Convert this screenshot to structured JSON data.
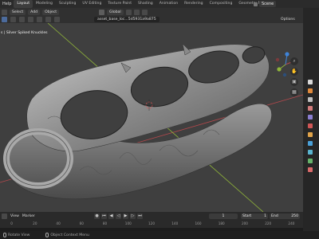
{
  "topbar": {
    "menus": [
      "Help",
      "Layout",
      "Modeling",
      "Sculpting",
      "UV Editing",
      "Texture Paint",
      "Shading",
      "Animation",
      "Rendering",
      "Compositing",
      "Geometry No"
    ],
    "scene_label": "Scene"
  },
  "header": {
    "select": "Select",
    "add": "Add",
    "object": "Object",
    "transform_orientation": "Global"
  },
  "header2": {
    "filename": "asset_base_loc...5d5931a9a875",
    "options": "Options"
  },
  "viewport": {
    "object_label": "s | Silver Spiked Knuckles",
    "colors": {
      "background": "#3f3f3f",
      "x_axis": "#b5484c",
      "y_axis": "#8fb33a",
      "z_axis": "#3f84d8",
      "object_light": "#b8b8b8",
      "object_dark": "#5a5a5a"
    }
  },
  "timeline": {
    "view": "View",
    "marker": "Marker",
    "current_frame": "1",
    "start_label": "Start",
    "start_value": "1",
    "end_label": "End",
    "end_value": "250",
    "ruler": [
      "0",
      "20",
      "40",
      "60",
      "80",
      "100",
      "120",
      "140",
      "160",
      "180",
      "200",
      "220",
      "240"
    ]
  },
  "statusbar": {
    "left": "Rotate View",
    "middle": "Object Context Menu"
  }
}
